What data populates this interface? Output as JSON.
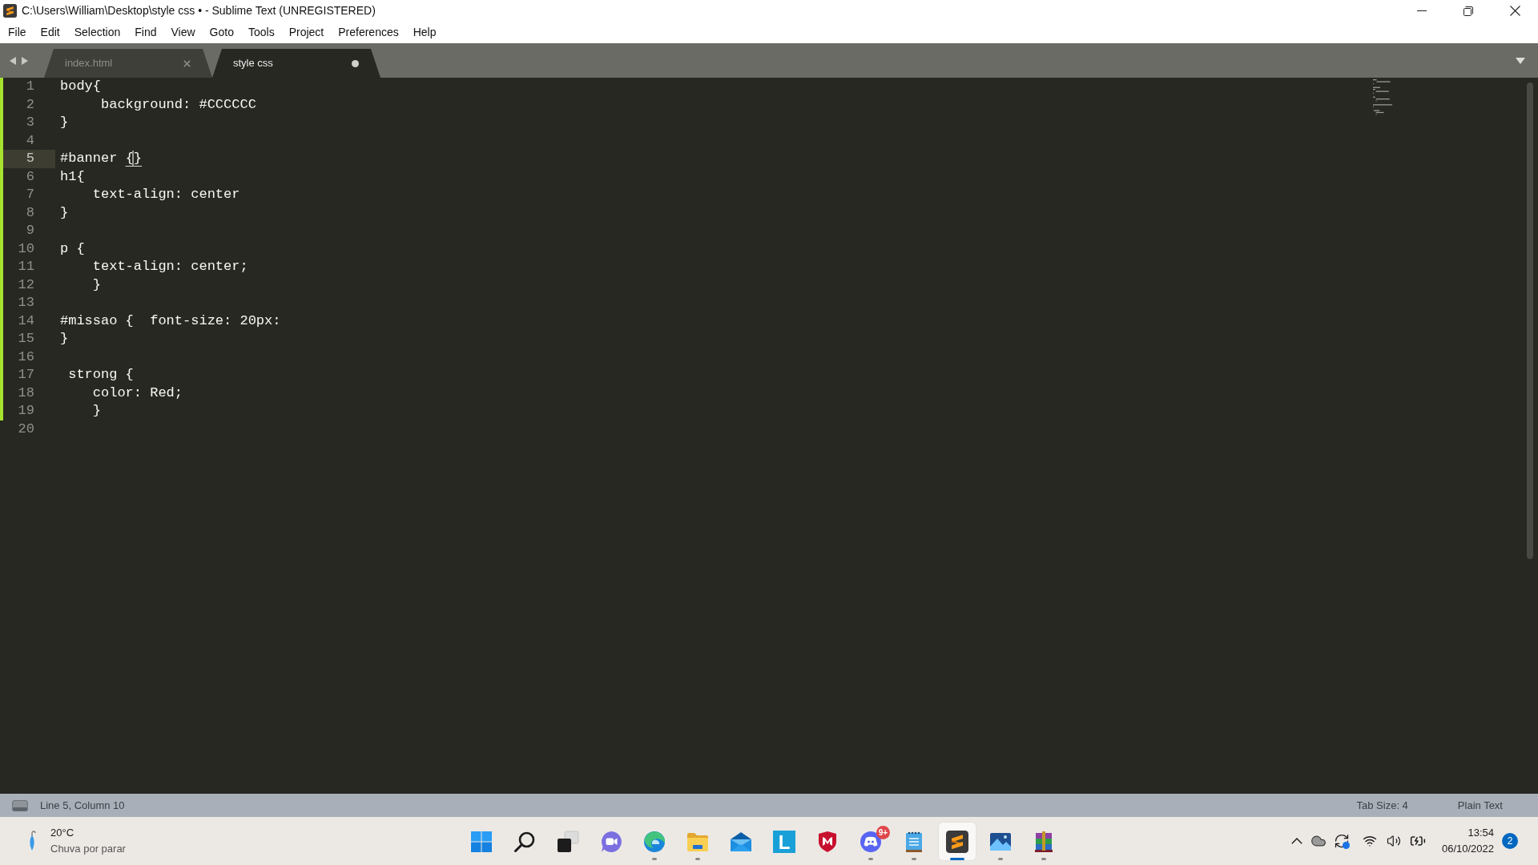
{
  "window": {
    "title": "C:\\Users\\William\\Desktop\\style css • - Sublime Text (UNREGISTERED)"
  },
  "menu": [
    "File",
    "Edit",
    "Selection",
    "Find",
    "View",
    "Goto",
    "Tools",
    "Project",
    "Preferences",
    "Help"
  ],
  "tabs": [
    {
      "label": "index.html",
      "selected": false,
      "modified": false
    },
    {
      "label": "style css",
      "selected": true,
      "modified": true
    }
  ],
  "editor": {
    "lines": [
      {
        "number": "1",
        "text": "body{",
        "modified": true,
        "current": false
      },
      {
        "number": "2",
        "text": "     background: #CCCCCC",
        "modified": true,
        "current": false
      },
      {
        "number": "3",
        "text": "}",
        "modified": true,
        "current": false
      },
      {
        "number": "4",
        "modified": true,
        "current": false
      },
      {
        "number": "5",
        "parts": [
          {
            "kind": "text",
            "text": "#banner "
          },
          {
            "kind": "bracket",
            "text": "{"
          },
          {
            "kind": "cursor"
          },
          {
            "kind": "bracket",
            "text": "}"
          }
        ],
        "modified": true,
        "current": true
      },
      {
        "number": "6",
        "text": "h1{",
        "modified": true,
        "current": false
      },
      {
        "number": "7",
        "text": "    text-align: center",
        "modified": true,
        "current": false
      },
      {
        "number": "8",
        "text": "}",
        "modified": true,
        "current": false
      },
      {
        "number": "9",
        "modified": true,
        "current": false
      },
      {
        "number": "10",
        "text": "p {",
        "modified": true,
        "current": false
      },
      {
        "number": "11",
        "text": "    text-align: center;",
        "modified": true,
        "current": false
      },
      {
        "number": "12",
        "text": "    }",
        "modified": true,
        "current": false
      },
      {
        "number": "13",
        "modified": true,
        "current": false
      },
      {
        "number": "14",
        "text": "#missao {  font-size: 20px:",
        "modified": true,
        "current": false
      },
      {
        "number": "15",
        "text": "}",
        "modified": true,
        "current": false
      },
      {
        "number": "16",
        "modified": true,
        "current": false
      },
      {
        "number": "17",
        "text": " strong {",
        "modified": true,
        "current": false
      },
      {
        "number": "18",
        "text": "    color: Red;",
        "modified": true,
        "current": false
      },
      {
        "number": "19",
        "text": "    }",
        "modified": true,
        "current": false
      },
      {
        "number": "20",
        "modified": false,
        "current": false
      }
    ]
  },
  "status_bar": {
    "position": "Line 5, Column 10",
    "tab_size": "Tab Size: 4",
    "syntax": "Plain Text"
  },
  "taskbar": {
    "weather": {
      "temperature": "20°C",
      "condition": "Chuva por parar"
    },
    "apps": [
      {
        "kind": "start",
        "running": false,
        "selected": false
      },
      {
        "kind": "search",
        "running": false,
        "selected": false
      },
      {
        "kind": "task_view",
        "running": false,
        "selected": false
      },
      {
        "kind": "meet",
        "running": false,
        "selected": false
      },
      {
        "kind": "browser",
        "running": true,
        "selected": false
      },
      {
        "kind": "files",
        "running": true,
        "selected": false
      },
      {
        "kind": "mail",
        "running": false,
        "selected": false
      },
      {
        "kind": "letter",
        "label": "L",
        "running": false,
        "selected": false
      },
      {
        "kind": "shield",
        "running": false,
        "selected": false
      },
      {
        "kind": "gamepad",
        "badge": "9+",
        "running": true,
        "selected": false
      },
      {
        "kind": "notes",
        "running": true,
        "selected": false
      },
      {
        "kind": "editor",
        "running": true,
        "selected": true
      },
      {
        "kind": "photos",
        "running": true,
        "selected": false
      },
      {
        "kind": "archive",
        "running": true,
        "selected": false
      }
    ],
    "tray": {
      "time": "13:54",
      "date": "06/10/2022",
      "notifications": "2"
    }
  }
}
